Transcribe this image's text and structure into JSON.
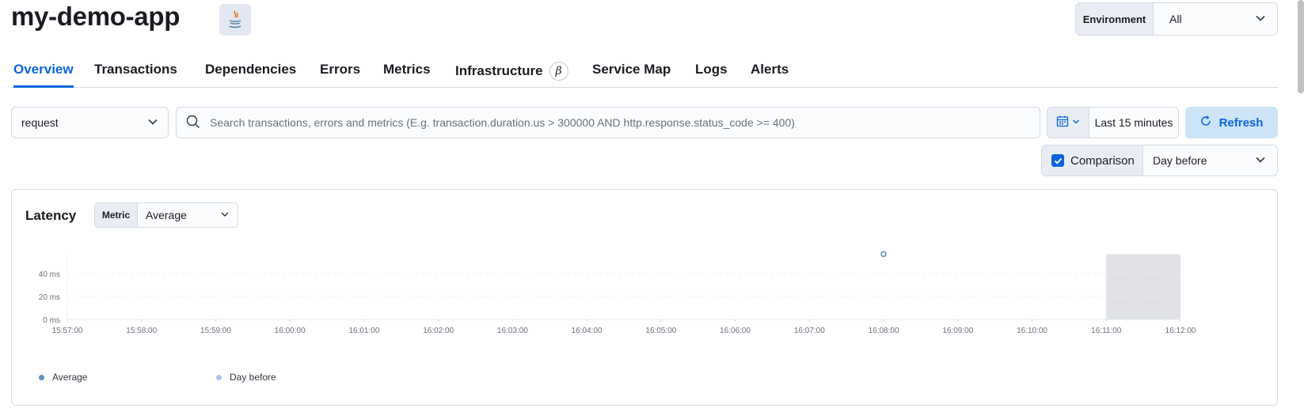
{
  "app": {
    "title": "my-demo-app",
    "agent_icon": "java-icon"
  },
  "environment": {
    "label": "Environment",
    "value": "All"
  },
  "tabs": [
    {
      "label": "Overview",
      "active": true
    },
    {
      "label": "Transactions"
    },
    {
      "label": "Dependencies"
    },
    {
      "label": "Errors"
    },
    {
      "label": "Metrics"
    },
    {
      "label": "Infrastructure",
      "badge": "β"
    },
    {
      "label": "Service Map"
    },
    {
      "label": "Logs"
    },
    {
      "label": "Alerts"
    }
  ],
  "filters": {
    "transaction_type": "request",
    "search_placeholder": "Search transactions, errors and metrics (E.g. transaction.duration.us > 300000 AND http.response.status_code >= 400)",
    "date_range": "Last 15 minutes",
    "refresh_label": "Refresh",
    "comparison_label": "Comparison",
    "comparison_checked": true,
    "comparison_value": "Day before"
  },
  "latency": {
    "title": "Latency",
    "metric_label": "Metric",
    "metric_value": "Average"
  },
  "colors": {
    "accent": "#0b64dd",
    "series_average": "#6092c0",
    "series_day_before": "#a8c5e4",
    "shade": "#e0e2e7"
  },
  "chart_data": {
    "type": "line",
    "x": [
      "15:57:00",
      "15:58:00",
      "15:59:00",
      "16:00:00",
      "16:01:00",
      "16:02:00",
      "16:03:00",
      "16:04:00",
      "16:05:00",
      "16:06:00",
      "16:07:00",
      "16:08:00",
      "16:09:00",
      "16:10:00",
      "16:11:00",
      "16:12:00"
    ],
    "y_ticks": [
      "0 ms",
      "20 ms",
      "40 ms"
    ],
    "ylim": [
      0,
      57
    ],
    "grid": true,
    "legend_placement": "bottom-left",
    "series": [
      {
        "name": "Average",
        "points": [
          {
            "x": "16:08:00",
            "y": 57
          }
        ]
      },
      {
        "name": "Day before",
        "points": []
      }
    ],
    "shaded_range": [
      "16:11:00",
      "16:12:00"
    ]
  }
}
